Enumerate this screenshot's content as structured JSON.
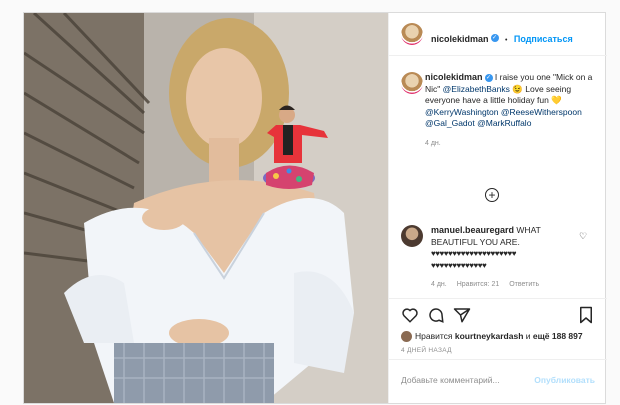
{
  "header": {
    "username": "nicolekidman",
    "follow_label": "Подписаться",
    "separator": "•"
  },
  "caption": {
    "username": "nicolekidman",
    "text_1": "I raise you one \"Mick on a Nic\"",
    "mention_1": "@ElizabethBanks",
    "emoji_1": "😉",
    "text_2": "Love seeing everyone have a little holiday fun",
    "emoji_2": "💛",
    "mention_2": "@KerryWashington",
    "mention_3": "@ReeseWitherspoon",
    "mention_4": "@Gal_Gadot",
    "mention_5": "@MarkRuffalo",
    "time": "4 дн."
  },
  "comment": {
    "username": "manuel.beauregard",
    "text": "WHAT BEAUTIFUL YOU ARE.",
    "hearts_line_1": "♥♥♥♥♥♥♥♥♥♥♥♥♥♥♥♥♥♥♥♥",
    "hearts_line_2": "♥♥♥♥♥♥♥♥♥♥♥♥♥",
    "time": "4 дн.",
    "likes": "Нравится: 21",
    "reply": "Ответить"
  },
  "likes": {
    "prefix": "Нравится",
    "user": "kourtneykardash",
    "middle": "и",
    "rest": "ещё 188 897"
  },
  "posted_ago": "4 ДНЕЙ НАЗАД",
  "add_comment": {
    "placeholder": "Добавьте комментарий...",
    "publish": "Опубликовать"
  },
  "colors": {
    "accent": "#0095f6",
    "verified": "#3897f0",
    "muted": "#8e8e8e",
    "border": "#dbdbdb"
  },
  "icons": [
    "verified-badge-icon",
    "plus-circle-icon",
    "heart-icon",
    "comment-icon",
    "share-icon",
    "bookmark-icon"
  ]
}
